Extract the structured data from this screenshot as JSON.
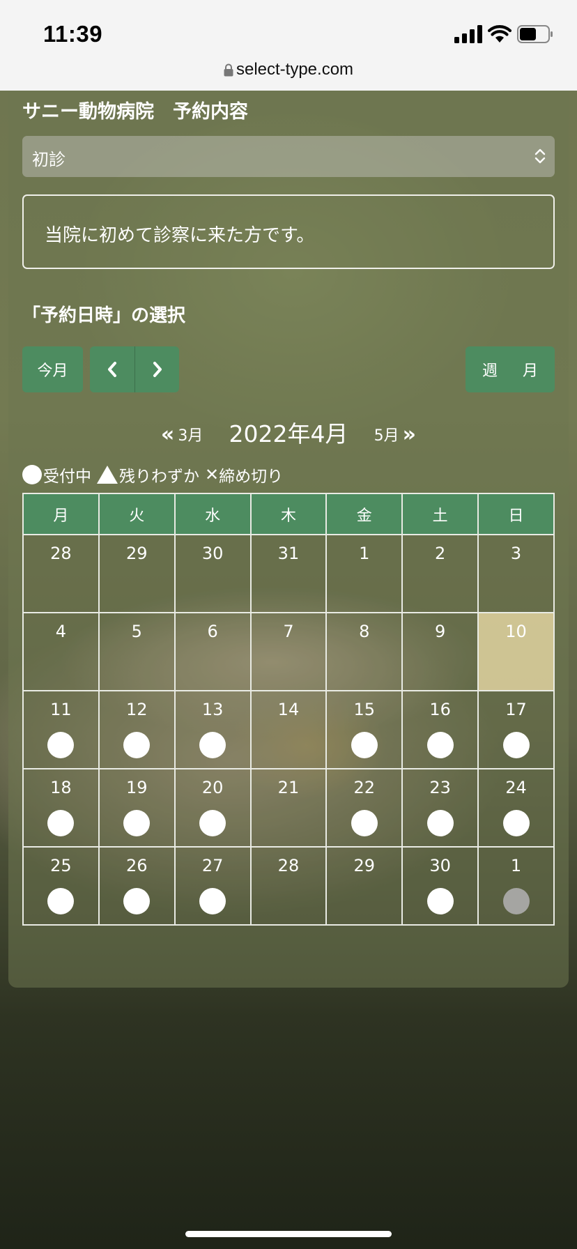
{
  "status_bar": {
    "time": "11:39",
    "url": "select-type.com"
  },
  "page": {
    "title": "サニー動物病院　予約内容",
    "select_value": "初診",
    "description": "当院に初めて診察に来た方です。",
    "section_heading": "「予約日時」の選択"
  },
  "toolbar": {
    "today_label": "今月",
    "week_label": "週",
    "month_label": "月"
  },
  "month_nav": {
    "prev": "3月",
    "current": "2022年4月",
    "next": "5月"
  },
  "legend": {
    "available": "受付中",
    "few_left": "残りわずか",
    "closed": "締め切り"
  },
  "colors": {
    "accent_green": "#4d8c60",
    "today_highlight": "#e1d2a0",
    "marker_white": "#ffffff",
    "marker_grey": "#a5a5a2"
  },
  "calendar": {
    "weekdays": [
      "月",
      "火",
      "水",
      "木",
      "金",
      "土",
      "日"
    ],
    "weeks": [
      [
        {
          "day": "28",
          "mark": ""
        },
        {
          "day": "29",
          "mark": ""
        },
        {
          "day": "30",
          "mark": ""
        },
        {
          "day": "31",
          "mark": ""
        },
        {
          "day": "1",
          "mark": ""
        },
        {
          "day": "2",
          "mark": ""
        },
        {
          "day": "3",
          "mark": ""
        }
      ],
      [
        {
          "day": "4",
          "mark": ""
        },
        {
          "day": "5",
          "mark": ""
        },
        {
          "day": "6",
          "mark": ""
        },
        {
          "day": "7",
          "mark": ""
        },
        {
          "day": "8",
          "mark": ""
        },
        {
          "day": "9",
          "mark": ""
        },
        {
          "day": "10",
          "mark": "",
          "today": true
        }
      ],
      [
        {
          "day": "11",
          "mark": "available"
        },
        {
          "day": "12",
          "mark": "available"
        },
        {
          "day": "13",
          "mark": "available"
        },
        {
          "day": "14",
          "mark": ""
        },
        {
          "day": "15",
          "mark": "available"
        },
        {
          "day": "16",
          "mark": "available"
        },
        {
          "day": "17",
          "mark": "available"
        }
      ],
      [
        {
          "day": "18",
          "mark": "available"
        },
        {
          "day": "19",
          "mark": "available"
        },
        {
          "day": "20",
          "mark": "available"
        },
        {
          "day": "21",
          "mark": ""
        },
        {
          "day": "22",
          "mark": "available"
        },
        {
          "day": "23",
          "mark": "available"
        },
        {
          "day": "24",
          "mark": "available"
        }
      ],
      [
        {
          "day": "25",
          "mark": "available"
        },
        {
          "day": "26",
          "mark": "available"
        },
        {
          "day": "27",
          "mark": "available"
        },
        {
          "day": "28",
          "mark": ""
        },
        {
          "day": "29",
          "mark": ""
        },
        {
          "day": "30",
          "mark": "available"
        },
        {
          "day": "1",
          "mark": "unavailable"
        }
      ]
    ]
  }
}
